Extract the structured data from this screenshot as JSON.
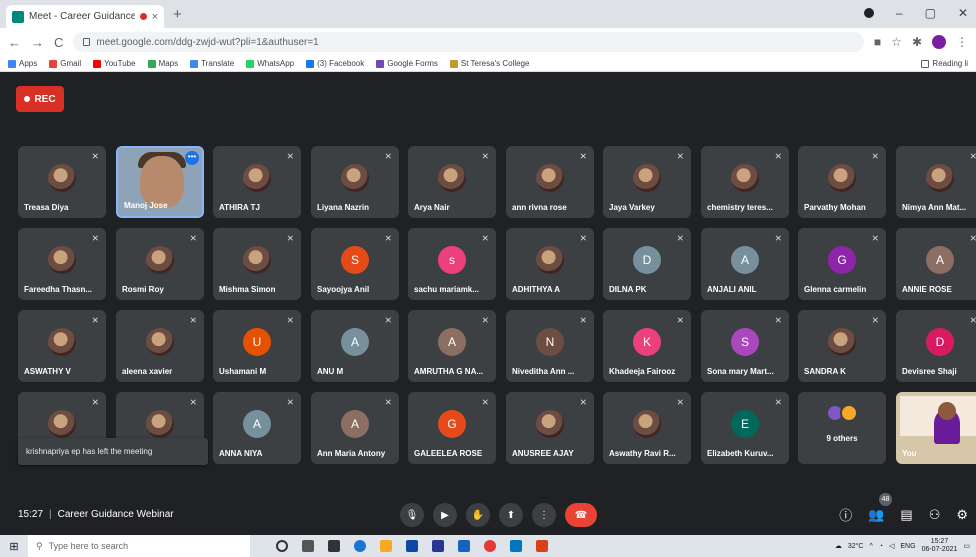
{
  "browser": {
    "tab_title": "Meet - Career Guidance Wi",
    "tab_close": "×",
    "new_tab": "+",
    "url": "meet.google.com/ddg-zwjd-wut?pli=1&authuser=1",
    "win_min": "–",
    "win_max": "▢",
    "win_close": "✕"
  },
  "bookmarks": [
    {
      "label": "Apps",
      "color": "#4285f4"
    },
    {
      "label": "Gmail",
      "color": "#ea4335"
    },
    {
      "label": "YouTube",
      "color": "#ff0000"
    },
    {
      "label": "Maps",
      "color": "#34a853"
    },
    {
      "label": "Translate",
      "color": "#4285f4"
    },
    {
      "label": "WhatsApp",
      "color": "#25d366"
    },
    {
      "label": "(3) Facebook",
      "color": "#1877f2"
    },
    {
      "label": "Google Forms",
      "color": "#7248b9"
    },
    {
      "label": "St Teresa's College",
      "color": "#c49a2c"
    }
  ],
  "reading_list": "Reading li",
  "rec_label": "REC",
  "participants": [
    {
      "name": "Treasa Diya",
      "type": "photo"
    },
    {
      "name": "Manoj Jose",
      "type": "camera"
    },
    {
      "name": "ATHIRA TJ",
      "type": "photo"
    },
    {
      "name": "Liyana Nazrin",
      "type": "photo"
    },
    {
      "name": "Arya Nair",
      "type": "photo"
    },
    {
      "name": "ann rivna rose",
      "type": "photo"
    },
    {
      "name": "Jaya Varkey",
      "type": "photo"
    },
    {
      "name": "chemistry teres...",
      "type": "photo"
    },
    {
      "name": "Parvathy Mohan",
      "type": "photo"
    },
    {
      "name": "Nimya Ann Mat...",
      "type": "photo"
    },
    {
      "name": "Fareedha Thasn...",
      "type": "photo"
    },
    {
      "name": "Rosmi Roy",
      "type": "photo"
    },
    {
      "name": "Mishma Simon",
      "type": "photo"
    },
    {
      "name": "Sayoojya Anil",
      "type": "letter",
      "letter": "S",
      "color": "#e64a19"
    },
    {
      "name": "sachu mariamk...",
      "type": "letter",
      "letter": "s",
      "color": "#ec407a"
    },
    {
      "name": "ADHITHYA A",
      "type": "photo"
    },
    {
      "name": "DILNA PK",
      "type": "letter",
      "letter": "D",
      "color": "#78909c"
    },
    {
      "name": "ANJALI ANIL",
      "type": "letter",
      "letter": "A",
      "color": "#78909c"
    },
    {
      "name": "Glenna carmelin",
      "type": "letter",
      "letter": "G",
      "color": "#8e24aa"
    },
    {
      "name": "ANNIE ROSE",
      "type": "letter",
      "letter": "A",
      "color": "#8d6e63"
    },
    {
      "name": "ASWATHY V",
      "type": "photo"
    },
    {
      "name": "aleena xavier",
      "type": "photo"
    },
    {
      "name": "Ushamani M",
      "type": "letter",
      "letter": "U",
      "color": "#e65100"
    },
    {
      "name": "ANU M",
      "type": "letter",
      "letter": "A",
      "color": "#78909c"
    },
    {
      "name": "AMRUTHA G NA...",
      "type": "letter",
      "letter": "A",
      "color": "#8d6e63"
    },
    {
      "name": "Niveditha Ann ...",
      "type": "letter",
      "letter": "N",
      "color": "#6d4c41"
    },
    {
      "name": "Khadeeja Fairooz",
      "type": "letter",
      "letter": "K",
      "color": "#ec407a"
    },
    {
      "name": "Sona mary Mart...",
      "type": "letter",
      "letter": "S",
      "color": "#ab47bc"
    },
    {
      "name": "SANDRA K",
      "type": "photo"
    },
    {
      "name": "Devisree Shaji",
      "type": "letter",
      "letter": "D",
      "color": "#d81b60"
    },
    {
      "name": "",
      "type": "photo"
    },
    {
      "name": "",
      "type": "photo"
    },
    {
      "name": "ANNA NIYA",
      "type": "letter",
      "letter": "A",
      "color": "#78909c"
    },
    {
      "name": "Ann Maria Antony",
      "type": "letter",
      "letter": "A",
      "color": "#8d6e63"
    },
    {
      "name": "GALEELEA ROSE",
      "type": "letter",
      "letter": "G",
      "color": "#e64a19"
    },
    {
      "name": "ANUSREE AJAY",
      "type": "photo"
    },
    {
      "name": "Aswathy Ravi R...",
      "type": "photo"
    },
    {
      "name": "Elizabeth Kuruv...",
      "type": "letter",
      "letter": "E",
      "color": "#00695c"
    },
    {
      "name": "9 others",
      "type": "others"
    },
    {
      "name": "You",
      "type": "self"
    }
  ],
  "toast": "krishnapriya ep has left the meeting",
  "meeting": {
    "time": "15:27",
    "separator": "|",
    "title": "Career Guidance Webinar",
    "participant_count": "48"
  },
  "taskbar": {
    "search_placeholder": "Type here to search",
    "weather": "32°C",
    "lang": "ENG",
    "time": "15:27",
    "date": "06-07-2021"
  }
}
